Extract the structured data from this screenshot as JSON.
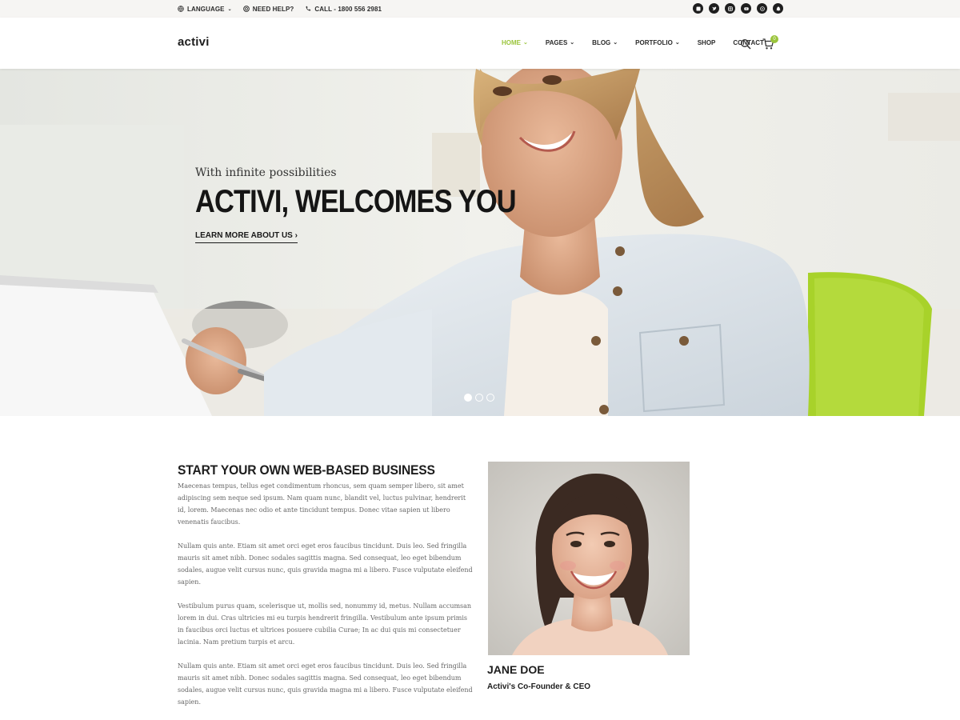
{
  "topbar": {
    "language": "LANGUAGE",
    "help": "NEED HELP?",
    "call": "CALL - 1800 556 2981",
    "social_icons": [
      "facebook-icon",
      "twitter-icon",
      "instagram-icon",
      "youtube-icon",
      "dribbble-icon",
      "snapchat-icon"
    ]
  },
  "header": {
    "logo": "activi",
    "nav": [
      {
        "label": "HOME",
        "active": true,
        "dropdown": true
      },
      {
        "label": "PAGES",
        "dropdown": true
      },
      {
        "label": "BLOG",
        "dropdown": true
      },
      {
        "label": "PORTFOLIO",
        "dropdown": true
      },
      {
        "label": "SHOP",
        "dropdown": false
      },
      {
        "label": "CONTACT",
        "dropdown": false
      }
    ],
    "cart_count": "0"
  },
  "hero": {
    "subtitle": "With infinite possibilities",
    "title": "ACTIVI, WELCOMES YOU",
    "link": "LEARN MORE ABOUT US ›",
    "slide_active": 1,
    "slide_count": 3
  },
  "content": {
    "title": "START YOUR OWN WEB-BASED BUSINESS",
    "paragraphs": [
      "Maecenas tempus, tellus eget condimentum rhoncus, sem quam semper libero, sit amet adipiscing sem neque sed ipsum. Nam quam nunc, blandit vel, luctus pulvinar, hendrerit id, lorem. Maecenas nec odio et ante tincidunt tempus. Donec vitae sapien ut libero venenatis faucibus.",
      "Nullam quis ante. Etiam sit amet orci eget eros faucibus tincidunt. Duis leo. Sed fringilla mauris sit amet nibh. Donec sodales sagittis magna. Sed consequat, leo eget bibendum sodales, augue velit cursus nunc, quis gravida magna mi a libero. Fusce vulputate eleifend sapien.",
      "Vestibulum purus quam, scelerisque ut, mollis sed, nonummy id, metus. Nullam accumsan lorem in dui. Cras ultricies mi eu turpis hendrerit fringilla. Vestibulum ante ipsum primis in faucibus orci luctus et ultrices posuere cubilia Curae; In ac dui quis mi consectetuer lacinia. Nam pretium turpis et arcu.",
      "Nullam quis ante. Etiam sit amet orci eget eros faucibus tincidunt. Duis leo. Sed fringilla mauris sit amet nibh. Donec sodales sagittis magna. Sed consequat, leo eget bibendum sodales, augue velit cursus nunc, quis gravida magna mi a libero. Fusce vulputate eleifend sapien."
    ]
  },
  "profile": {
    "name": "JANE DOE",
    "role": "Activi's Co-Founder & CEO"
  },
  "colors": {
    "accent": "#9ac43b",
    "dark": "#1d1d1d",
    "topbar_bg": "#f6f5f3"
  }
}
